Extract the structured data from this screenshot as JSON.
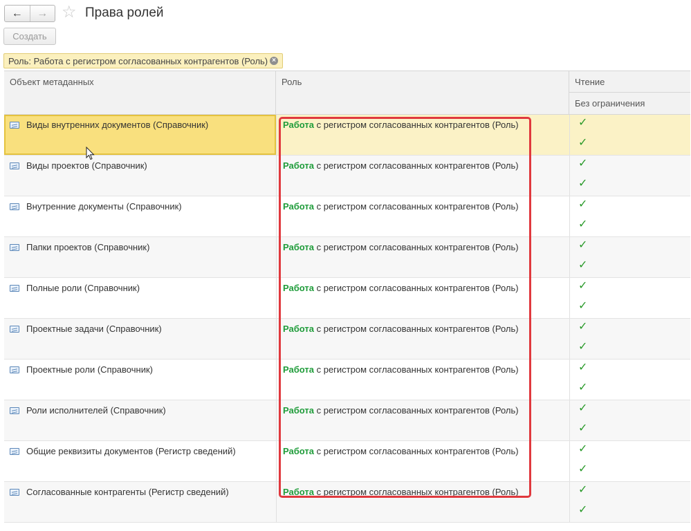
{
  "header": {
    "back_glyph": "🡐",
    "forward_glyph": "🡒",
    "back_label": "←",
    "forward_label": "→",
    "star_glyph": "☆",
    "title": "Права ролей"
  },
  "toolbar": {
    "create_label": "Создать"
  },
  "filter": {
    "label": "Роль: Работа с регистром согласованных контрагентов (Роль)",
    "close_glyph": "×"
  },
  "grid": {
    "columns": {
      "object": "Объект метаданных",
      "role": "Роль",
      "read": "Чтение",
      "read_sub": "Без ограничения"
    },
    "check_glyph": "✓",
    "role_strong": "Работа",
    "role_rest": " с регистром согласованных контрагентов (Роль)",
    "rows": [
      {
        "object": "Виды внутренних документов (Справочник)"
      },
      {
        "object": "Виды проектов (Справочник)"
      },
      {
        "object": "Внутренние документы (Справочник)"
      },
      {
        "object": "Папки проектов (Справочник)"
      },
      {
        "object": "Полные роли (Справочник)"
      },
      {
        "object": "Проектные задачи (Справочник)"
      },
      {
        "object": "Проектные роли (Справочник)"
      },
      {
        "object": "Роли исполнителей (Справочник)"
      },
      {
        "object": "Общие реквизиты документов (Регистр сведений)"
      },
      {
        "object": "Согласованные контрагенты (Регистр сведений)"
      }
    ]
  },
  "colors": {
    "highlight_border": "#e0393e",
    "selected_row": "#fbf2c6",
    "role_green": "#1f9c3a",
    "check_green": "#2a9a2a"
  }
}
